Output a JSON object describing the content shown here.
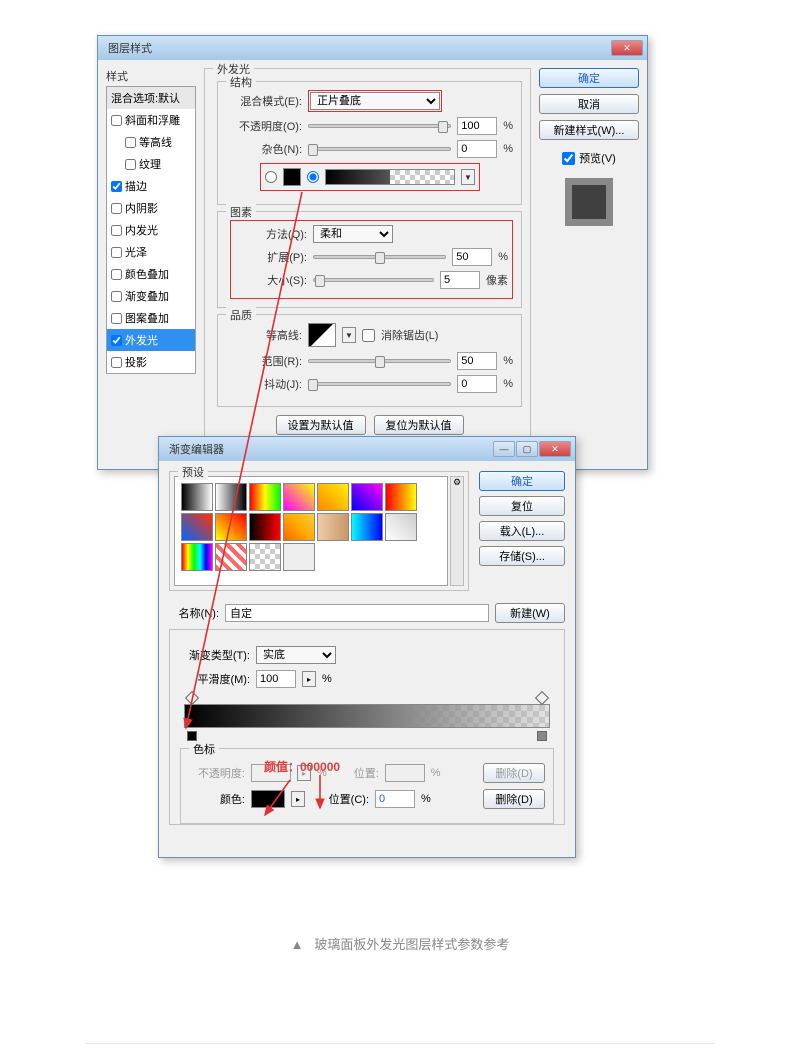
{
  "layerStyle": {
    "title": "图层样式",
    "sideLabel": "样式",
    "items": [
      {
        "label": "混合选项:默认",
        "head": true
      },
      {
        "label": "斜面和浮雕",
        "checked": false
      },
      {
        "label": "等高线",
        "indent": true
      },
      {
        "label": "纹理",
        "indent": true
      },
      {
        "label": "描边",
        "checked": true
      },
      {
        "label": "内阴影",
        "checked": false
      },
      {
        "label": "内发光",
        "checked": false
      },
      {
        "label": "光泽",
        "checked": false
      },
      {
        "label": "颜色叠加",
        "checked": false
      },
      {
        "label": "渐变叠加",
        "checked": false
      },
      {
        "label": "图案叠加",
        "checked": false
      },
      {
        "label": "外发光",
        "checked": true,
        "active": true
      },
      {
        "label": "投影",
        "checked": false
      }
    ],
    "outerGlow": {
      "groupTitle": "外发光",
      "structure": {
        "glabel": "结构",
        "blendLabel": "混合模式(E):",
        "blendVal": "正片叠底",
        "opacityLabel": "不透明度(O):",
        "opacityVal": "100",
        "opacityPct": "%",
        "noiseLabel": "杂色(N):",
        "noiseVal": "0",
        "noisePct": "%"
      },
      "element": {
        "glabel": "图素",
        "methodLabel": "方法(Q):",
        "methodVal": "柔和",
        "spreadLabel": "扩展(P):",
        "spreadVal": "50",
        "spreadPct": "%",
        "sizeLabel": "大小(S):",
        "sizeVal": "5",
        "sizeUnit": "像素"
      },
      "quality": {
        "glabel": "品质",
        "contourLabel": "等高线:",
        "antialias": "消除锯齿(L)",
        "rangeLabel": "范围(R):",
        "rangeVal": "50",
        "rangePct": "%",
        "jitterLabel": "抖动(J):",
        "jitterVal": "0",
        "jitterPct": "%"
      },
      "defaultBtn": "设置为默认值",
      "resetBtn": "复位为默认值"
    },
    "ok": "确定",
    "cancel": "取消",
    "newStyle": "新建样式(W)...",
    "previewLabel": "预览(V)"
  },
  "gradEditor": {
    "title": "渐变编辑器",
    "presetLabel": "预设",
    "ok": "确定",
    "reset": "复位",
    "load": "载入(L)...",
    "save": "存储(S)...",
    "nameLabel": "名称(N):",
    "nameVal": "自定",
    "new": "新建(W)",
    "typeLabel": "渐变类型(T):",
    "typeVal": "实底",
    "smoothLabel": "平滑度(M):",
    "smoothVal": "100",
    "smoothPct": "%",
    "stopsLabel": "色标",
    "opacityLabel": "不透明度:",
    "opacityPct": "%",
    "posLabel1": "位置:",
    "pos1Pct": "%",
    "del1": "删除(D)",
    "colorLabel": "颜色:",
    "posLabel2": "位置(C):",
    "pos2Val": "0",
    "pos2Pct": "%",
    "del2": "删除(D)",
    "hint": "颜值：000000",
    "presets": [
      "linear-gradient(90deg,#000,#fff)",
      "linear-gradient(90deg,#fff,#000)",
      "linear-gradient(90deg,#f00,#ff0,#0f0)",
      "linear-gradient(45deg,#f0f,#ff0)",
      "linear-gradient(45deg,#ff8800,#ffee00)",
      "linear-gradient(45deg,#00f,#f0f)",
      "linear-gradient(90deg,#f00,#ff0)",
      "linear-gradient(45deg,#06f,#f30)",
      "linear-gradient(45deg,#ff0,#f00)",
      "linear-gradient(90deg,#000,#f00)",
      "linear-gradient(45deg,#f60,#fa0,#fc3)",
      "linear-gradient(90deg,#eecba8,#c89868)",
      "linear-gradient(90deg,#0ff,#00f)",
      "linear-gradient(45deg,#fff,#ccc)",
      "linear-gradient(90deg,#f00,#ff0,#0f0,#0ff,#00f,#f0f)",
      "repeating-linear-gradient(45deg,#f66 0 4px,#fff 4px 8px)",
      "repeating-conic-gradient(#ccc 0 25%,#fff 0 50%) 0 0/10px 10px",
      "linear-gradient(#eee,#eee)"
    ]
  },
  "caption": "玻璃面板外发光图层样式参数参考"
}
